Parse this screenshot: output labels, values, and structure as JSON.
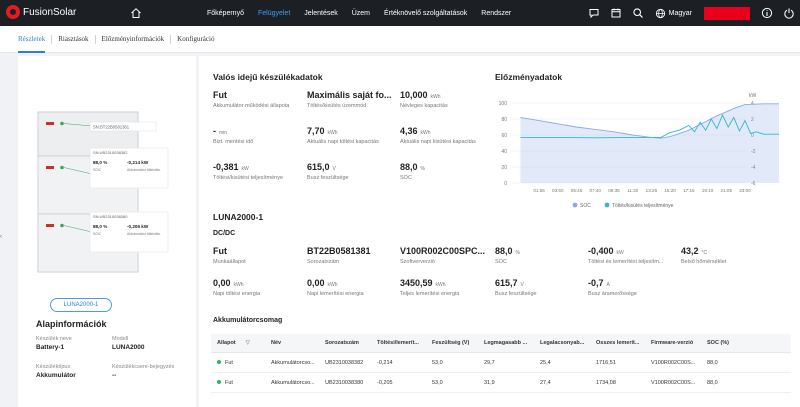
{
  "app": {
    "name": "FusionSolar"
  },
  "nav": {
    "items": [
      "Főképernyő",
      "Felügyelet",
      "Jelentések",
      "Üzem",
      "Értéknövelő szolgáltatások",
      "Rendszer"
    ],
    "active_index": 1
  },
  "header": {
    "language": "Magyar"
  },
  "tabs": [
    "Részletek",
    "Riasztások",
    "Előzményinformációk",
    "Konfiguráció"
  ],
  "left": {
    "device_image_labels": {
      "top_sn": "SN:BT22B0581381",
      "mid_sn": "SN:UB2310038382",
      "low_sn": "SN:UB2310038380",
      "m1_soc_val": "88,0 %",
      "m1_soc_lbl": "SOC",
      "m1_pwr_val": "-0,214 kW",
      "m1_pwr_lbl": "Akkumulátor töltés/kis.",
      "m2_soc_val": "88,0 %",
      "m2_soc_lbl": "SOC",
      "m2_pwr_val": "-0,205 kW",
      "m2_pwr_lbl": "Akkumulátor töltés/kis."
    },
    "unit_label": "LUNA2000-1",
    "basic_title": "Alapinformációk",
    "fields": {
      "device_name_k": "Készülék neve",
      "device_name_v": "Battery-1",
      "model_k": "Modell",
      "model_v": "LUNA2000",
      "device_type_k": "Készüléktípus",
      "device_type_v": "Akkumulátor",
      "replacement_k": "Készülékcsere-bejegyzés",
      "replacement_v": "--"
    }
  },
  "realtime": {
    "title": "Valós idejű készülékadatok",
    "metrics": [
      {
        "value": "Fut",
        "unit": "",
        "label": "Akkumulátor működési állapota"
      },
      {
        "value": "Maximális saját fo...",
        "unit": "",
        "label": "Töltés/kisütés üzemmód"
      },
      {
        "value": "10,000",
        "unit": "kWh",
        "label": "Névleges kapacitás"
      },
      {
        "value": "-",
        "unit": "min",
        "label": "Bizt. mentési idő"
      },
      {
        "value": "7,70",
        "unit": "kWh",
        "label": "Aktuális napi töltési kapacitás"
      },
      {
        "value": "4,36",
        "unit": "kWh",
        "label": "Aktuális napi kisütési kapacitás"
      },
      {
        "value": "-0,381",
        "unit": "kW",
        "label": "Töltési/kisütési teljesítménye"
      },
      {
        "value": "615,0",
        "unit": "V",
        "label": "Busz feszültsége"
      },
      {
        "value": "88,0",
        "unit": "%",
        "label": "SOC"
      }
    ]
  },
  "history": {
    "title": "Előzményadatok",
    "chart_data": {
      "type": "line",
      "title": "Előzményadatok",
      "x_ticks": [
        "01:55",
        "03:50",
        "05:45",
        "07:40",
        "09:35",
        "11:30",
        "13:25",
        "15:20",
        "17:15",
        "19:10",
        "21:05",
        "23:00"
      ],
      "y_left_ticks": [
        "100",
        "80",
        "60",
        "40",
        "20",
        "0"
      ],
      "y_right_ticks": [
        "4",
        "2",
        "0",
        "-2",
        "-4",
        "-6"
      ],
      "y_right_unit": "kW",
      "ylim_left": [
        0,
        100
      ],
      "ylim_right": [
        -6,
        4
      ],
      "legend": [
        "SOC",
        "Töltés/kisütés teljesítménye"
      ],
      "legend_position": "bottom",
      "series": [
        {
          "name": "SOC",
          "axis": "left",
          "color": "#8aa9e6",
          "points": [
            [
              0,
              82
            ],
            [
              1,
              78
            ],
            [
              2,
              74
            ],
            [
              3,
              70
            ],
            [
              4,
              67
            ],
            [
              5,
              64
            ],
            [
              6,
              60
            ],
            [
              7,
              57
            ],
            [
              7.5,
              56
            ],
            [
              8,
              58
            ],
            [
              8.5,
              62
            ],
            [
              9,
              66
            ],
            [
              9.5,
              72
            ],
            [
              10,
              78
            ],
            [
              10.5,
              84
            ],
            [
              11,
              89
            ],
            [
              11.5,
              94
            ],
            [
              12,
              98
            ],
            [
              13,
              99
            ],
            [
              14,
              99
            ],
            [
              15,
              99
            ],
            [
              16,
              97
            ],
            [
              17,
              92
            ],
            [
              18,
              88
            ],
            [
              19,
              88
            ]
          ]
        },
        {
          "name": "Töltés/kisütés teljesítménye",
          "axis": "right",
          "color": "#33b7c9",
          "points": [
            [
              0,
              -0.3
            ],
            [
              2,
              -0.3
            ],
            [
              4,
              -0.35
            ],
            [
              6,
              -0.3
            ],
            [
              7.5,
              -0.3
            ],
            [
              8,
              0.3
            ],
            [
              8.5,
              0.6
            ],
            [
              9,
              1.2
            ],
            [
              9.3,
              0.4
            ],
            [
              9.6,
              1.6
            ],
            [
              9.9,
              0.6
            ],
            [
              10.2,
              2.0
            ],
            [
              10.5,
              0.8
            ],
            [
              10.8,
              2.5
            ],
            [
              11.1,
              1.0
            ],
            [
              11.4,
              2.2
            ],
            [
              11.7,
              0.5
            ],
            [
              12,
              1.8
            ],
            [
              12.3,
              0.2
            ],
            [
              12.6,
              0.4
            ],
            [
              13,
              0.1
            ],
            [
              14,
              0.1
            ],
            [
              15,
              0.05
            ],
            [
              16,
              -0.1
            ],
            [
              17,
              -0.4
            ],
            [
              18,
              -0.4
            ],
            [
              19,
              -0.38
            ]
          ]
        }
      ]
    }
  },
  "unit_section": {
    "title": "LUNA2000-1",
    "dcdc_title": "DC/DC",
    "metrics": [
      {
        "value": "Fut",
        "unit": "",
        "label": "Munkaállapot"
      },
      {
        "value": "BT22B0581381",
        "unit": "",
        "label": "Sorozatszám"
      },
      {
        "value": "V100R002C00SPC...",
        "unit": "",
        "label": "Szoftververzió"
      },
      {
        "value": "88,0",
        "unit": "%",
        "label": "SOC"
      },
      {
        "value": "-0,400",
        "unit": "kW",
        "label": "Töltési és lemerítési teljesítm..."
      },
      {
        "value": "43,2",
        "unit": "°C",
        "label": "Belső hőmérséklet"
      },
      {
        "value": "0,00",
        "unit": "kWh",
        "label": "Napi töltési energia"
      },
      {
        "value": "0,00",
        "unit": "kWh",
        "label": "Napi lemerítési energia"
      },
      {
        "value": "3450,59",
        "unit": "kWh",
        "label": "Teljes lemerítési energia"
      },
      {
        "value": "615,7",
        "unit": "V",
        "label": "Busz feszültsége"
      },
      {
        "value": "-0,7",
        "unit": "A",
        "label": "Busz áramerőssége"
      }
    ]
  },
  "pack": {
    "title": "Akkumulátorcsomag",
    "columns": [
      "Állapot",
      "Név",
      "Sorozatszám",
      "Töltési/lemerít...",
      "Feszültség (V)",
      "Legmagasabb ...",
      "Legalacsonyab...",
      "Összes lemerít...",
      "Firmware-verzió",
      "SOC (%)"
    ],
    "rows": [
      [
        "Fut",
        "Akkumulátorcso...",
        "UB2310038382",
        "-0,214",
        "53,0",
        "29,7",
        "25,4",
        "1716,51",
        "V100R002C00S...",
        "88,0"
      ],
      [
        "Fut",
        "Akkumulátorcso...",
        "UB2310038380",
        "-0,205",
        "53,0",
        "31,9",
        "27,4",
        "1734,08",
        "V100R002C00S...",
        "88,0"
      ]
    ]
  }
}
